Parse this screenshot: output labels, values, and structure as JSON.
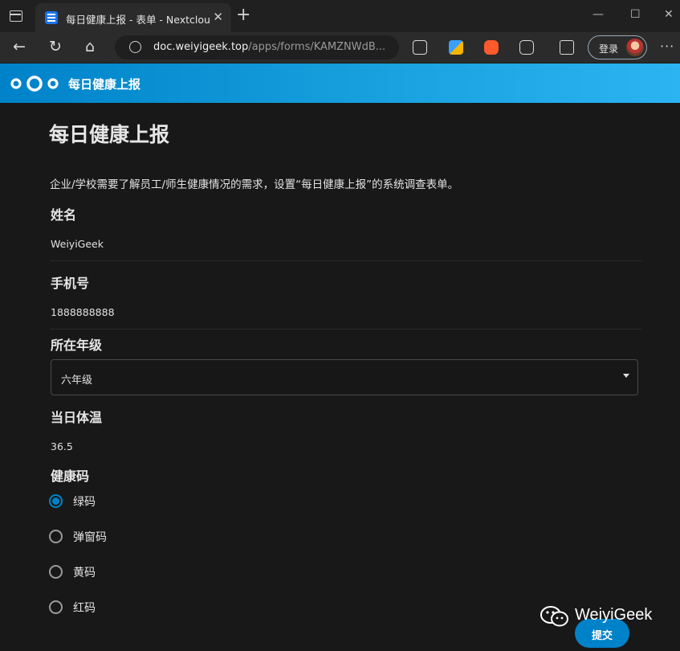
{
  "browser": {
    "tab_title": "每日健康上报 - 表单 - Nextcloud",
    "url_host": "doc.weiyigeek.top",
    "url_path": "/apps/forms/KAMZNWdB...",
    "login_label": "登录"
  },
  "header": {
    "app_title": "每日健康上报"
  },
  "form": {
    "title": "每日健康上报",
    "description": "企业/学校需要了解员工/师生健康情况的需求，设置“每日健康上报”的系统调查表单。",
    "q_name": "姓名",
    "a_name": "WeiyiGeek",
    "q_phone": "手机号",
    "a_phone": "1888888888",
    "q_grade": "所在年级",
    "a_grade": "六年级",
    "q_temp": "当日体温",
    "a_temp": "36.5",
    "q_health_code": "健康码",
    "health_code_options": [
      "绿码",
      "弹窗码",
      "黄码",
      "红码"
    ],
    "health_code_selected": "绿码",
    "submit_label": "提交"
  },
  "watermark": {
    "text": "WeiyiGeek"
  },
  "colors": {
    "accent": "#0082c9",
    "background": "#181818"
  }
}
